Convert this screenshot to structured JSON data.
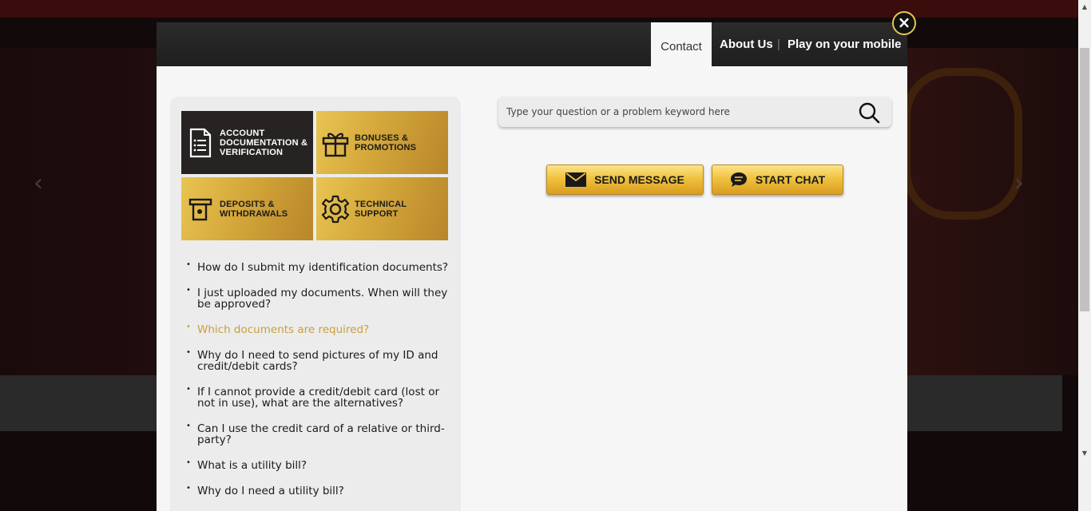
{
  "header": {
    "tabs": [
      {
        "label": "Contact",
        "active": true
      },
      {
        "label": "About Us",
        "active": false
      },
      {
        "label": "Play on your mobile",
        "active": false
      }
    ],
    "separator": "|"
  },
  "close": {
    "icon": "close-icon",
    "glyph": "×"
  },
  "categories": [
    {
      "label": "Account Documentation & Verification",
      "icon": "document-list-icon",
      "active": true
    },
    {
      "label": "Bonuses & Promotions",
      "icon": "gift-icon",
      "active": false
    },
    {
      "label": "Deposits & Withdrawals",
      "icon": "atm-cash-icon",
      "active": false
    },
    {
      "label": "Technical Support",
      "icon": "gear-icon",
      "active": false
    }
  ],
  "faq": [
    {
      "text": "How do I submit my identification documents?",
      "active": false
    },
    {
      "text": "I just uploaded my documents. When will they be approved?",
      "active": false
    },
    {
      "text": "Which documents are required?",
      "active": true
    },
    {
      "text": "Why do I need to send pictures of my ID and credit/debit cards?",
      "active": false
    },
    {
      "text": "If I cannot provide a credit/debit card (lost or not in use), what are the alternatives?",
      "active": false
    },
    {
      "text": "Can I use the credit card of a relative or third-party?",
      "active": false
    },
    {
      "text": "What is a utility bill?",
      "active": false
    },
    {
      "text": "Why do I need a utility bill?",
      "active": false
    }
  ],
  "search": {
    "placeholder": "Type your question or a problem keyword here",
    "value": ""
  },
  "actions": {
    "send_message": "SEND MESSAGE",
    "start_chat": "START CHAT"
  },
  "colors": {
    "accent_gold": "#e0b53a",
    "active_faq": "#c9a03a",
    "header_bg": "#262626",
    "panel_bg": "#f6f6f6"
  }
}
